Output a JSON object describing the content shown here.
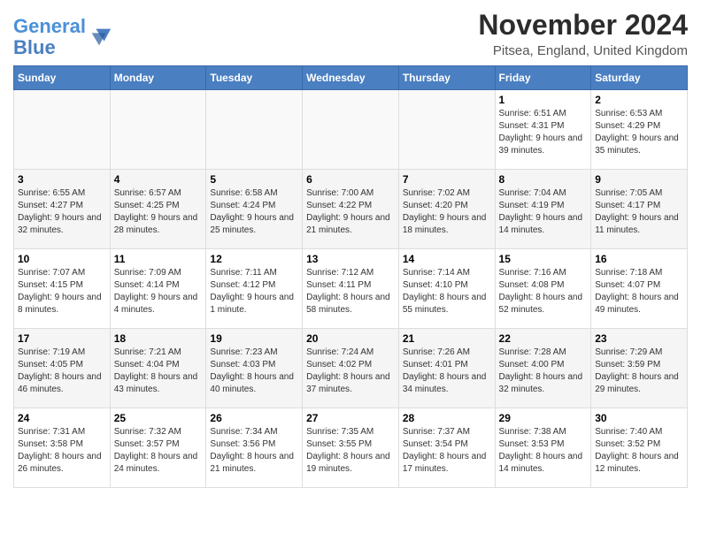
{
  "logo": {
    "text_general": "General",
    "text_blue": "Blue"
  },
  "title": "November 2024",
  "subtitle": "Pitsea, England, United Kingdom",
  "days_of_week": [
    "Sunday",
    "Monday",
    "Tuesday",
    "Wednesday",
    "Thursday",
    "Friday",
    "Saturday"
  ],
  "weeks": [
    [
      {
        "day": "",
        "info": ""
      },
      {
        "day": "",
        "info": ""
      },
      {
        "day": "",
        "info": ""
      },
      {
        "day": "",
        "info": ""
      },
      {
        "day": "",
        "info": ""
      },
      {
        "day": "1",
        "info": "Sunrise: 6:51 AM\nSunset: 4:31 PM\nDaylight: 9 hours and 39 minutes."
      },
      {
        "day": "2",
        "info": "Sunrise: 6:53 AM\nSunset: 4:29 PM\nDaylight: 9 hours and 35 minutes."
      }
    ],
    [
      {
        "day": "3",
        "info": "Sunrise: 6:55 AM\nSunset: 4:27 PM\nDaylight: 9 hours and 32 minutes."
      },
      {
        "day": "4",
        "info": "Sunrise: 6:57 AM\nSunset: 4:25 PM\nDaylight: 9 hours and 28 minutes."
      },
      {
        "day": "5",
        "info": "Sunrise: 6:58 AM\nSunset: 4:24 PM\nDaylight: 9 hours and 25 minutes."
      },
      {
        "day": "6",
        "info": "Sunrise: 7:00 AM\nSunset: 4:22 PM\nDaylight: 9 hours and 21 minutes."
      },
      {
        "day": "7",
        "info": "Sunrise: 7:02 AM\nSunset: 4:20 PM\nDaylight: 9 hours and 18 minutes."
      },
      {
        "day": "8",
        "info": "Sunrise: 7:04 AM\nSunset: 4:19 PM\nDaylight: 9 hours and 14 minutes."
      },
      {
        "day": "9",
        "info": "Sunrise: 7:05 AM\nSunset: 4:17 PM\nDaylight: 9 hours and 11 minutes."
      }
    ],
    [
      {
        "day": "10",
        "info": "Sunrise: 7:07 AM\nSunset: 4:15 PM\nDaylight: 9 hours and 8 minutes."
      },
      {
        "day": "11",
        "info": "Sunrise: 7:09 AM\nSunset: 4:14 PM\nDaylight: 9 hours and 4 minutes."
      },
      {
        "day": "12",
        "info": "Sunrise: 7:11 AM\nSunset: 4:12 PM\nDaylight: 9 hours and 1 minute."
      },
      {
        "day": "13",
        "info": "Sunrise: 7:12 AM\nSunset: 4:11 PM\nDaylight: 8 hours and 58 minutes."
      },
      {
        "day": "14",
        "info": "Sunrise: 7:14 AM\nSunset: 4:10 PM\nDaylight: 8 hours and 55 minutes."
      },
      {
        "day": "15",
        "info": "Sunrise: 7:16 AM\nSunset: 4:08 PM\nDaylight: 8 hours and 52 minutes."
      },
      {
        "day": "16",
        "info": "Sunrise: 7:18 AM\nSunset: 4:07 PM\nDaylight: 8 hours and 49 minutes."
      }
    ],
    [
      {
        "day": "17",
        "info": "Sunrise: 7:19 AM\nSunset: 4:05 PM\nDaylight: 8 hours and 46 minutes."
      },
      {
        "day": "18",
        "info": "Sunrise: 7:21 AM\nSunset: 4:04 PM\nDaylight: 8 hours and 43 minutes."
      },
      {
        "day": "19",
        "info": "Sunrise: 7:23 AM\nSunset: 4:03 PM\nDaylight: 8 hours and 40 minutes."
      },
      {
        "day": "20",
        "info": "Sunrise: 7:24 AM\nSunset: 4:02 PM\nDaylight: 8 hours and 37 minutes."
      },
      {
        "day": "21",
        "info": "Sunrise: 7:26 AM\nSunset: 4:01 PM\nDaylight: 8 hours and 34 minutes."
      },
      {
        "day": "22",
        "info": "Sunrise: 7:28 AM\nSunset: 4:00 PM\nDaylight: 8 hours and 32 minutes."
      },
      {
        "day": "23",
        "info": "Sunrise: 7:29 AM\nSunset: 3:59 PM\nDaylight: 8 hours and 29 minutes."
      }
    ],
    [
      {
        "day": "24",
        "info": "Sunrise: 7:31 AM\nSunset: 3:58 PM\nDaylight: 8 hours and 26 minutes."
      },
      {
        "day": "25",
        "info": "Sunrise: 7:32 AM\nSunset: 3:57 PM\nDaylight: 8 hours and 24 minutes."
      },
      {
        "day": "26",
        "info": "Sunrise: 7:34 AM\nSunset: 3:56 PM\nDaylight: 8 hours and 21 minutes."
      },
      {
        "day": "27",
        "info": "Sunrise: 7:35 AM\nSunset: 3:55 PM\nDaylight: 8 hours and 19 minutes."
      },
      {
        "day": "28",
        "info": "Sunrise: 7:37 AM\nSunset: 3:54 PM\nDaylight: 8 hours and 17 minutes."
      },
      {
        "day": "29",
        "info": "Sunrise: 7:38 AM\nSunset: 3:53 PM\nDaylight: 8 hours and 14 minutes."
      },
      {
        "day": "30",
        "info": "Sunrise: 7:40 AM\nSunset: 3:52 PM\nDaylight: 8 hours and 12 minutes."
      }
    ]
  ]
}
